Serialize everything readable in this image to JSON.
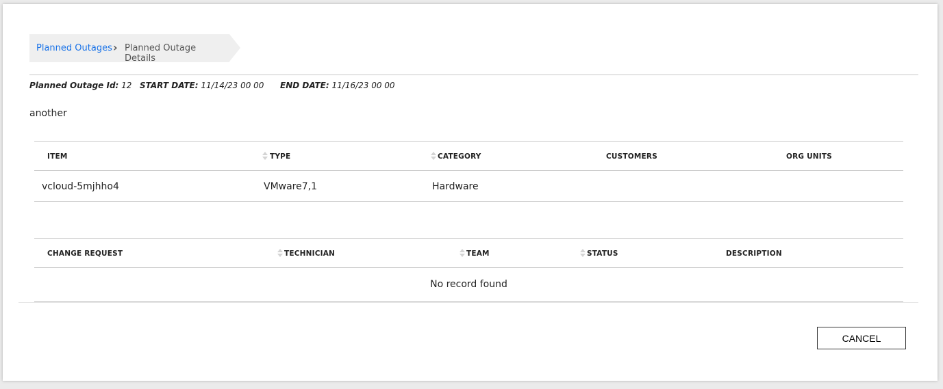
{
  "breadcrumb": {
    "parent": "Planned Outages",
    "current": "Planned Outage Details"
  },
  "meta": {
    "id_label": "Planned Outage Id:",
    "id_value": "12",
    "start_label": "START DATE:",
    "start_value": "11/14/23 00 00",
    "end_label": "END DATE:",
    "end_value": "11/16/23 00 00"
  },
  "description": "another",
  "items_table": {
    "headers": [
      "ITEM",
      "TYPE",
      "CATEGORY",
      "CUSTOMERS",
      "ORG UNITS"
    ],
    "rows": [
      [
        "vcloud-5mjhho4",
        "VMware7,1",
        "Hardware",
        "",
        ""
      ]
    ]
  },
  "changes_table": {
    "headers": [
      "CHANGE REQUEST",
      "TECHNICIAN",
      "TEAM",
      "STATUS",
      "DESCRIPTION"
    ],
    "empty": "No record found"
  },
  "cancel_label": "CANCEL",
  "colors": {
    "link": "#1a73e8",
    "border": "#c8c8c8"
  }
}
